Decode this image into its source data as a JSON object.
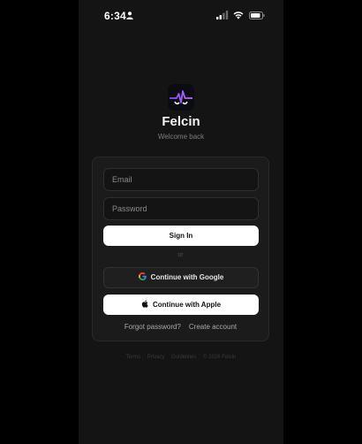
{
  "status_bar": {
    "time": "6:34",
    "person_icon": "person-icon",
    "signal_icon": "cellular-signal-icon",
    "wifi_icon": "wifi-icon",
    "battery_icon": "battery-icon"
  },
  "brand": {
    "logo_icon": "heartbeat-logo-icon",
    "app_name": "Felcin",
    "subtitle": "Welcome back",
    "accent": "#7c4dff"
  },
  "form": {
    "email_placeholder": "Email",
    "password_placeholder": "Password",
    "sign_in_label": "Sign In",
    "divider_text": "or",
    "google_label": "Continue with Google",
    "google_icon": "google-icon",
    "apple_label": "Continue with Apple",
    "apple_icon": "apple-icon",
    "forgot_password": "Forgot password?",
    "create_account": "Create account"
  },
  "footer": {
    "terms": "Terms",
    "privacy": "Privacy",
    "guidelines": "Guidelines",
    "copyright": "© 2026 Felcin"
  },
  "colors": {
    "background": "#141414",
    "card": "#1b1b1b",
    "primary_button": "#ffffff",
    "text": "#f2f2f2"
  }
}
